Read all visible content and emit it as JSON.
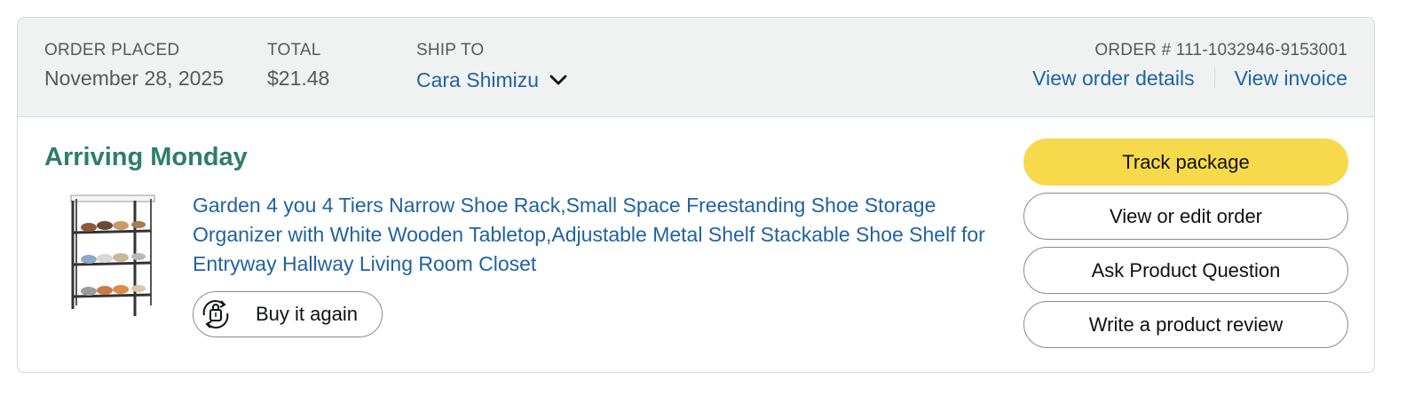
{
  "header": {
    "order_placed_label": "ORDER PLACED",
    "order_placed_value": "November 28, 2025",
    "total_label": "TOTAL",
    "total_value": "$21.48",
    "ship_to_label": "SHIP TO",
    "ship_to_value": "Cara Shimizu",
    "order_number_label": "ORDER # 111-1032946-9153001",
    "view_order_details": "View order details",
    "view_invoice": "View invoice"
  },
  "shipment": {
    "status": "Arriving Monday",
    "product_title": "Garden 4 you 4 Tiers Narrow Shoe Rack,Small Space Freestanding Shoe Storage Organizer with White Wooden Tabletop,Adjustable Metal Shelf Stackable Shoe Shelf for Entryway Hallway Living Room Closet",
    "buy_again_label": "Buy it again"
  },
  "actions": {
    "track_package": "Track package",
    "view_edit_order": "View or edit order",
    "ask_question": "Ask Product Question",
    "write_review": "Write a product review"
  },
  "colors": {
    "status_green": "#2e7d6b",
    "link_blue": "#2162a1",
    "primary_button": "#f7d94c",
    "header_bg": "#f0f2f2"
  },
  "icons": {
    "ship_to_dropdown": "chevron-down-icon",
    "buy_again": "reorder-bag-icon"
  }
}
